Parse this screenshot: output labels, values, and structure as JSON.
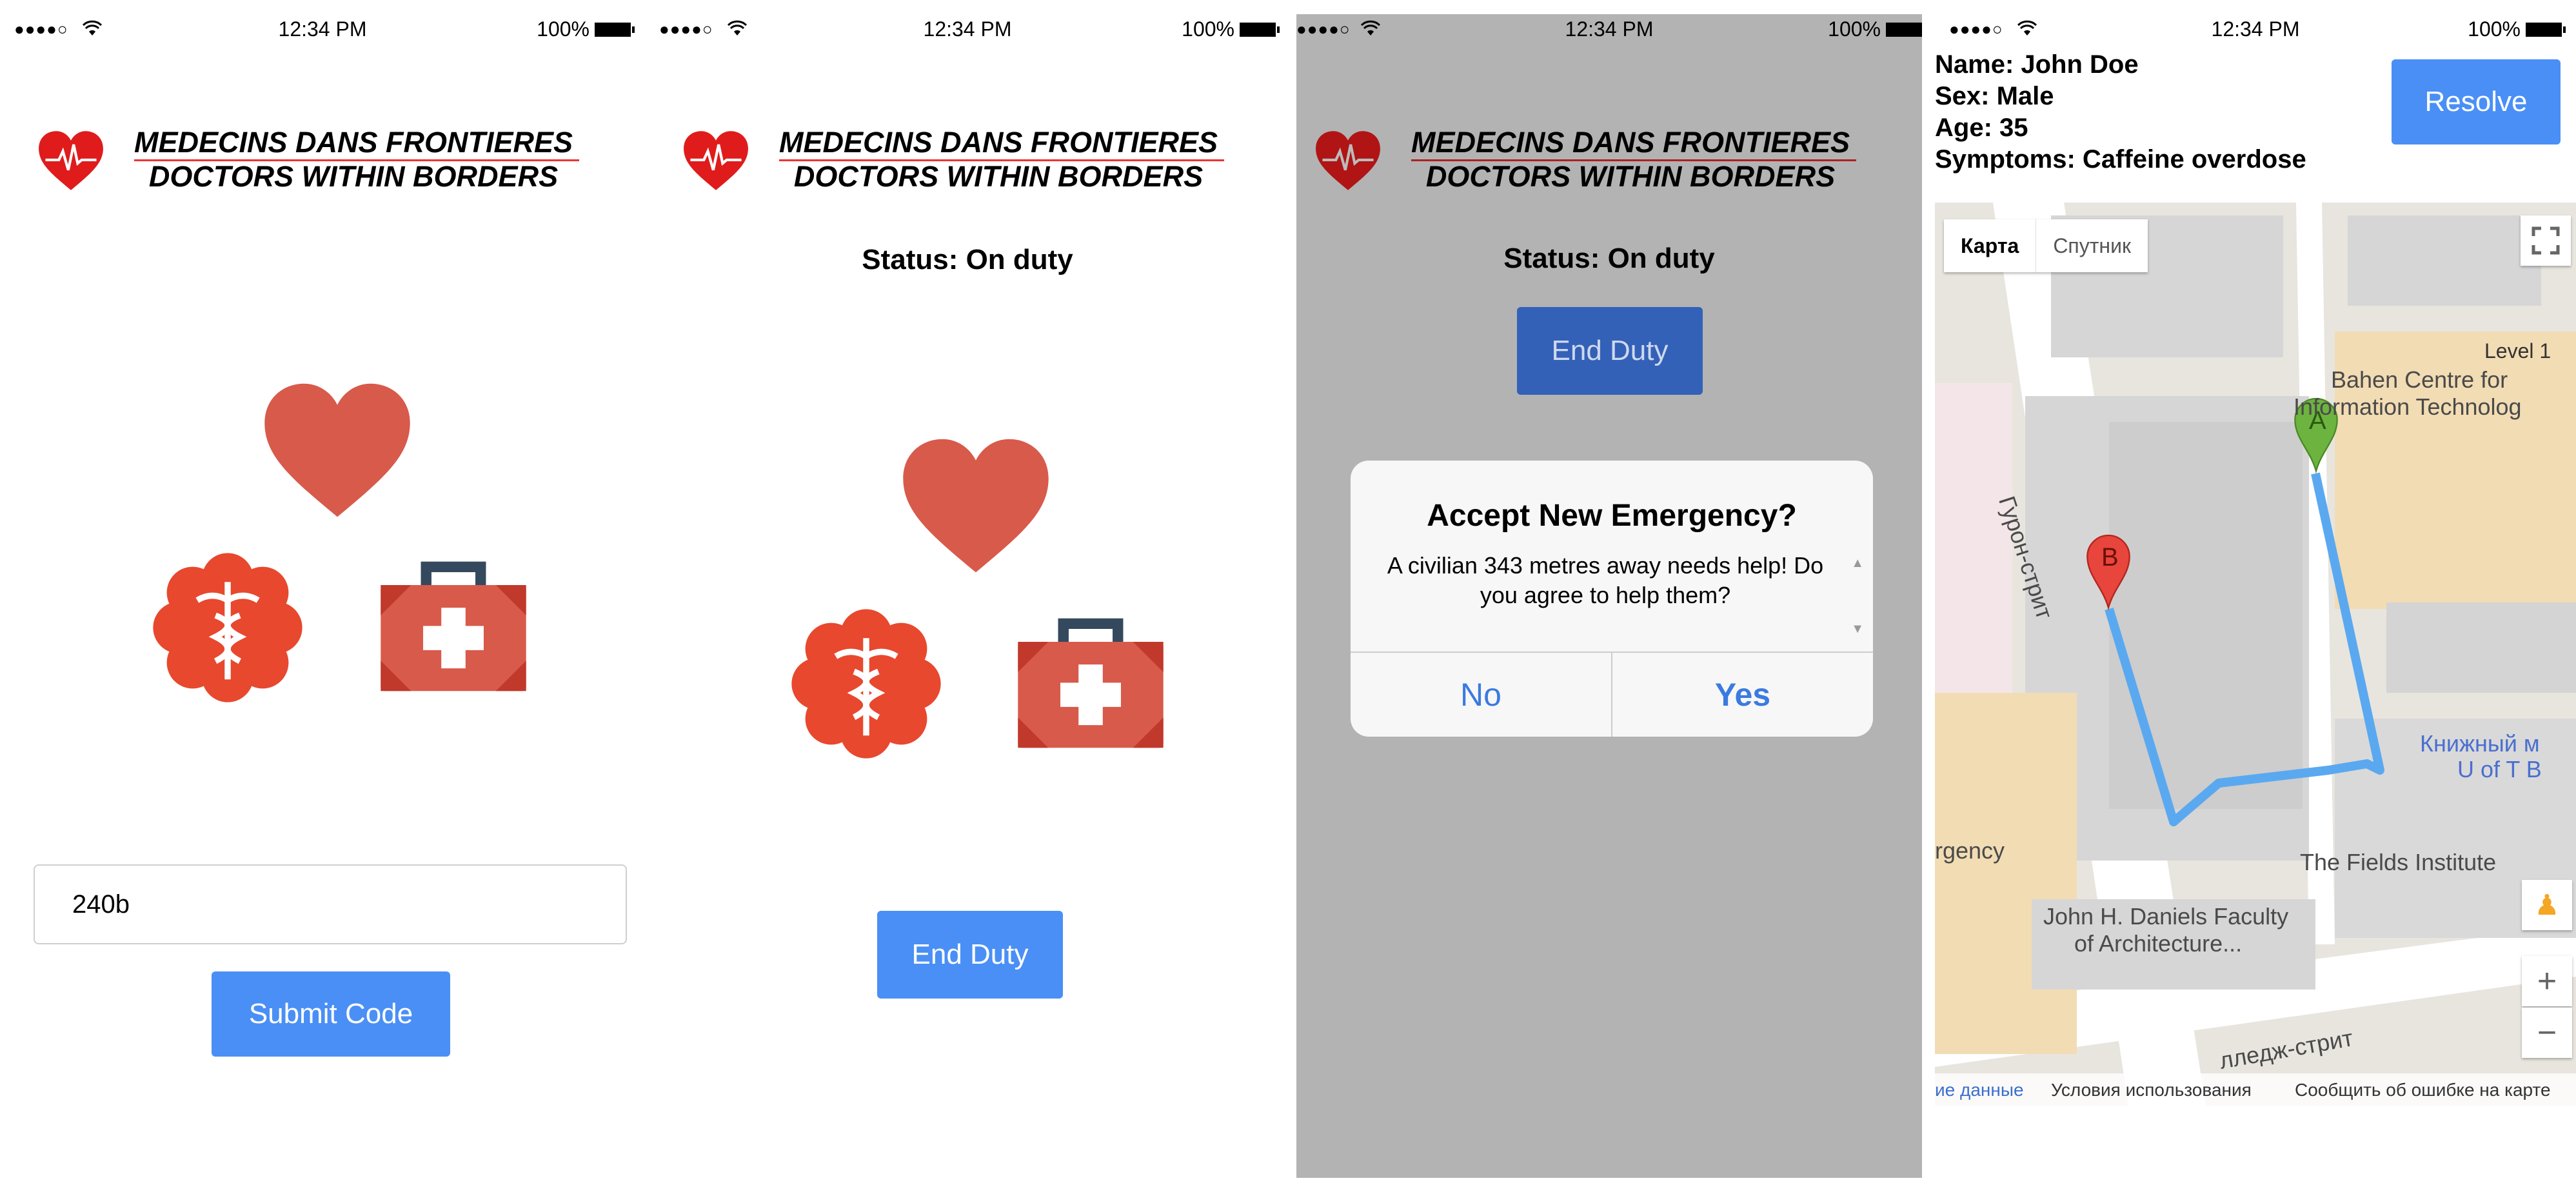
{
  "statusbar": {
    "signal": "●●●●○",
    "time": "12:34 PM",
    "battery": "100%"
  },
  "logo": {
    "line1": "MEDECINS DANS FRONTIERES",
    "line2": "DOCTORS WITHIN BORDERS"
  },
  "screen1": {
    "code_value": "240b",
    "submit_label": "Submit Code"
  },
  "screen2": {
    "status": "Status: On duty",
    "end_duty_label": "End Duty"
  },
  "screen3": {
    "status": "Status: On duty",
    "end_duty_label": "End Duty",
    "alert": {
      "title": "Accept New Emergency?",
      "message": "A civilian 343 metres away needs help! Do you agree to help them?",
      "no_label": "No",
      "yes_label": "Yes"
    }
  },
  "screen4": {
    "name": "Name: John Doe",
    "sex": "Sex: Male",
    "age": "Age: 35",
    "symptoms": "Symptoms: Caffeine overdose",
    "resolve_label": "Resolve",
    "map": {
      "map_tab": "Карта",
      "satellite_tab": "Спутник",
      "labels": {
        "level": "Level 1",
        "bahen1": "Bahen Centre for",
        "bahen2": "Information Technolog",
        "street_huron": "Гурон-стрит",
        "bookstore1": "Книжный м",
        "bookstore2": "U of T B",
        "fields": "The Fields Institute",
        "emergency": "rgency",
        "daniels1": "John H. Daniels Faculty",
        "daniels2": "of Architecture...",
        "street_college": "лледж-стрит"
      },
      "marker_a": "A",
      "marker_b": "B",
      "zoom_in": "+",
      "zoom_out": "−",
      "footer": {
        "data": "ие данные",
        "terms": "Условия использования",
        "report": "Сообщить об ошибке на карте"
      }
    }
  },
  "colors": {
    "button": "#4a8ff5",
    "heart": "#d85a4b",
    "route": "#5aa9f0"
  }
}
